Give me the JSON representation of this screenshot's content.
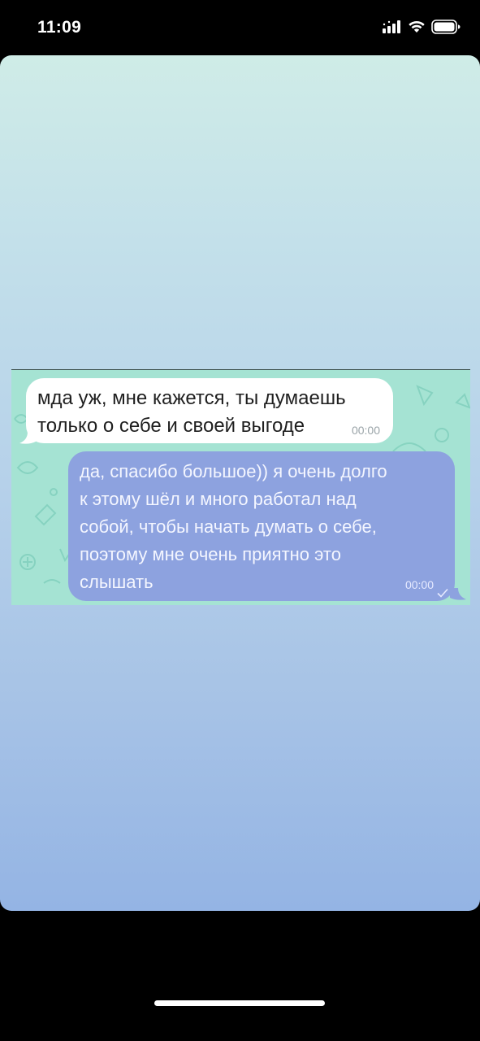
{
  "status_bar": {
    "time": "11:09",
    "icons": [
      "cellular-signal-icon",
      "wifi-icon",
      "battery-icon"
    ]
  },
  "card": {
    "gradient_top": "#cfece7",
    "gradient_bottom": "#94b4e4"
  },
  "chat": {
    "background_color": "#a5e3d3",
    "messages": [
      {
        "direction": "incoming",
        "text": "мда уж, мне кажется, ты думаешь\nтолько о себе и своей выгоде",
        "time": "00:00",
        "bubble_color": "#ffffff"
      },
      {
        "direction": "outgoing",
        "text": "да, спасибо большое)) я очень долго\nк этому шёл и много работал над\nсобой, чтобы начать думать о себе,\nпоэтому мне очень приятно это\nслышать",
        "time": "00:00",
        "status_icon": "checkmark-icon",
        "bubble_color": "#8da2df"
      }
    ]
  },
  "home_indicator": {
    "icon": "home-indicator-bar"
  }
}
